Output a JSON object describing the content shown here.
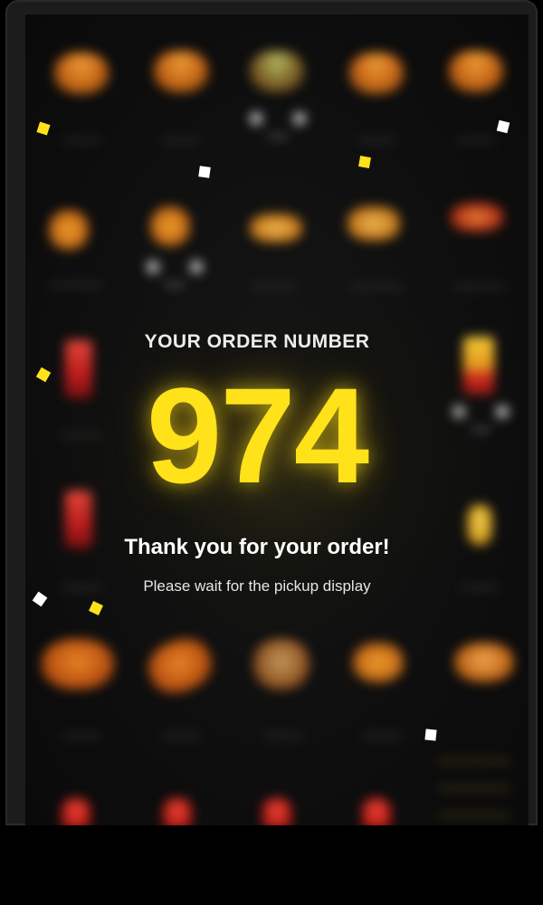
{
  "order_screen": {
    "heading": "YOUR ORDER NUMBER",
    "order_number": "974",
    "thank_you": "Thank you for your order!",
    "instruction": "Please wait for the pickup display"
  },
  "colors": {
    "accent": "#ffe21a",
    "background": "#0d0d0d",
    "confetti_yellow": "#ffe21a",
    "confetti_white": "#ffffff"
  },
  "background_menu_items": [
    "burger-icon",
    "burger-icon",
    "burger-icon",
    "burger-icon",
    "burger-icon",
    "nugget-icon",
    "nugget-icon",
    "wrap-icon",
    "wrap-icon",
    "wrap-icon",
    "drink-icon",
    "fries-icon",
    "drink-icon",
    "cup-icon",
    "chicken-icon",
    "chicken-icon",
    "chicken-icon",
    "nugget-icon",
    "chicken-icon",
    "drink-icon",
    "drink-icon",
    "drink-icon",
    "drink-icon"
  ]
}
